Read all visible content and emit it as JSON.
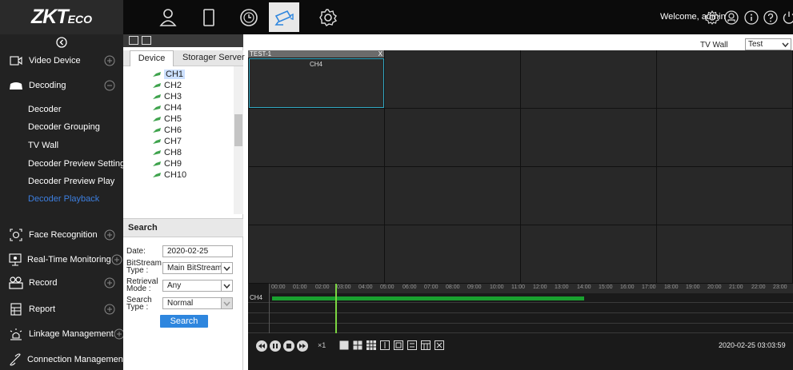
{
  "app": {
    "logo_main": "ZKT",
    "logo_sub": "ECO"
  },
  "topbar": {
    "welcome": "Welcome, admin",
    "nav_icons": [
      "person-icon",
      "door-icon",
      "clock-icon",
      "camera-icon",
      "settings-gear-icon"
    ],
    "right_icons": [
      "settings-icon",
      "user-profile-icon",
      "info-icon",
      "help-icon",
      "power-icon"
    ]
  },
  "sidebar": {
    "items": [
      {
        "label": "Video Device",
        "icon": "video-device-icon",
        "toggle": "+"
      },
      {
        "label": "Decoding",
        "icon": "decoding-icon",
        "toggle": "−"
      },
      {
        "label": "Face Recognition",
        "icon": "face-icon",
        "toggle": "+"
      },
      {
        "label": "Real-Time Monitoring",
        "icon": "monitor-icon",
        "toggle": "+"
      },
      {
        "label": "Record",
        "icon": "record-icon",
        "toggle": "+"
      },
      {
        "label": "Report",
        "icon": "report-icon",
        "toggle": "+"
      },
      {
        "label": "Linkage Management",
        "icon": "linkage-icon",
        "toggle": "+"
      },
      {
        "label": "Connection Management",
        "icon": "connection-icon",
        "toggle": "+"
      }
    ],
    "sub_items": [
      "Decoder",
      "Decoder Grouping",
      "TV Wall",
      "Decoder Preview Settings",
      "Decoder Preview Play",
      "Decoder Playback"
    ],
    "active_sub": "Decoder Playback"
  },
  "device_panel": {
    "tabs": [
      "Device",
      "Storager Server"
    ],
    "channels": [
      "CH1",
      "CH2",
      "CH3",
      "CH4",
      "CH5",
      "CH6",
      "CH7",
      "CH8",
      "CH9",
      "CH10"
    ],
    "selected_channel": "CH1",
    "search": {
      "title": "Search",
      "date_label": "Date:",
      "date_value": "2020-02-25",
      "bitstream_label_1": "BitStream",
      "bitstream_label_2": "Type :",
      "bitstream_value": "Main BitStream",
      "retrieval_label_1": "Retrieval",
      "retrieval_label_2": "Mode :",
      "retrieval_value": "Any",
      "searchtype_label_1": "Search",
      "searchtype_label_2": "Type :",
      "searchtype_value": "Normal",
      "button": "Search"
    }
  },
  "main": {
    "tvwall_label": "TV Wall",
    "tvwall_value": "Test",
    "screen": {
      "title": "TEST-1",
      "close": "X",
      "channel": "CH4"
    },
    "timeline": {
      "hours": [
        "00:00",
        "01:00",
        "02:00",
        "03:00",
        "04:00",
        "05:00",
        "06:00",
        "07:00",
        "08:00",
        "09:00",
        "10:00",
        "11:00",
        "12:00",
        "13:00",
        "14:00",
        "15:00",
        "16:00",
        "17:00",
        "18:00",
        "19:00",
        "20:00",
        "21:00",
        "22:00",
        "23:00"
      ],
      "row_label": "CH4",
      "speed": "×1",
      "time": "2020-02-25 03:03:59"
    }
  }
}
